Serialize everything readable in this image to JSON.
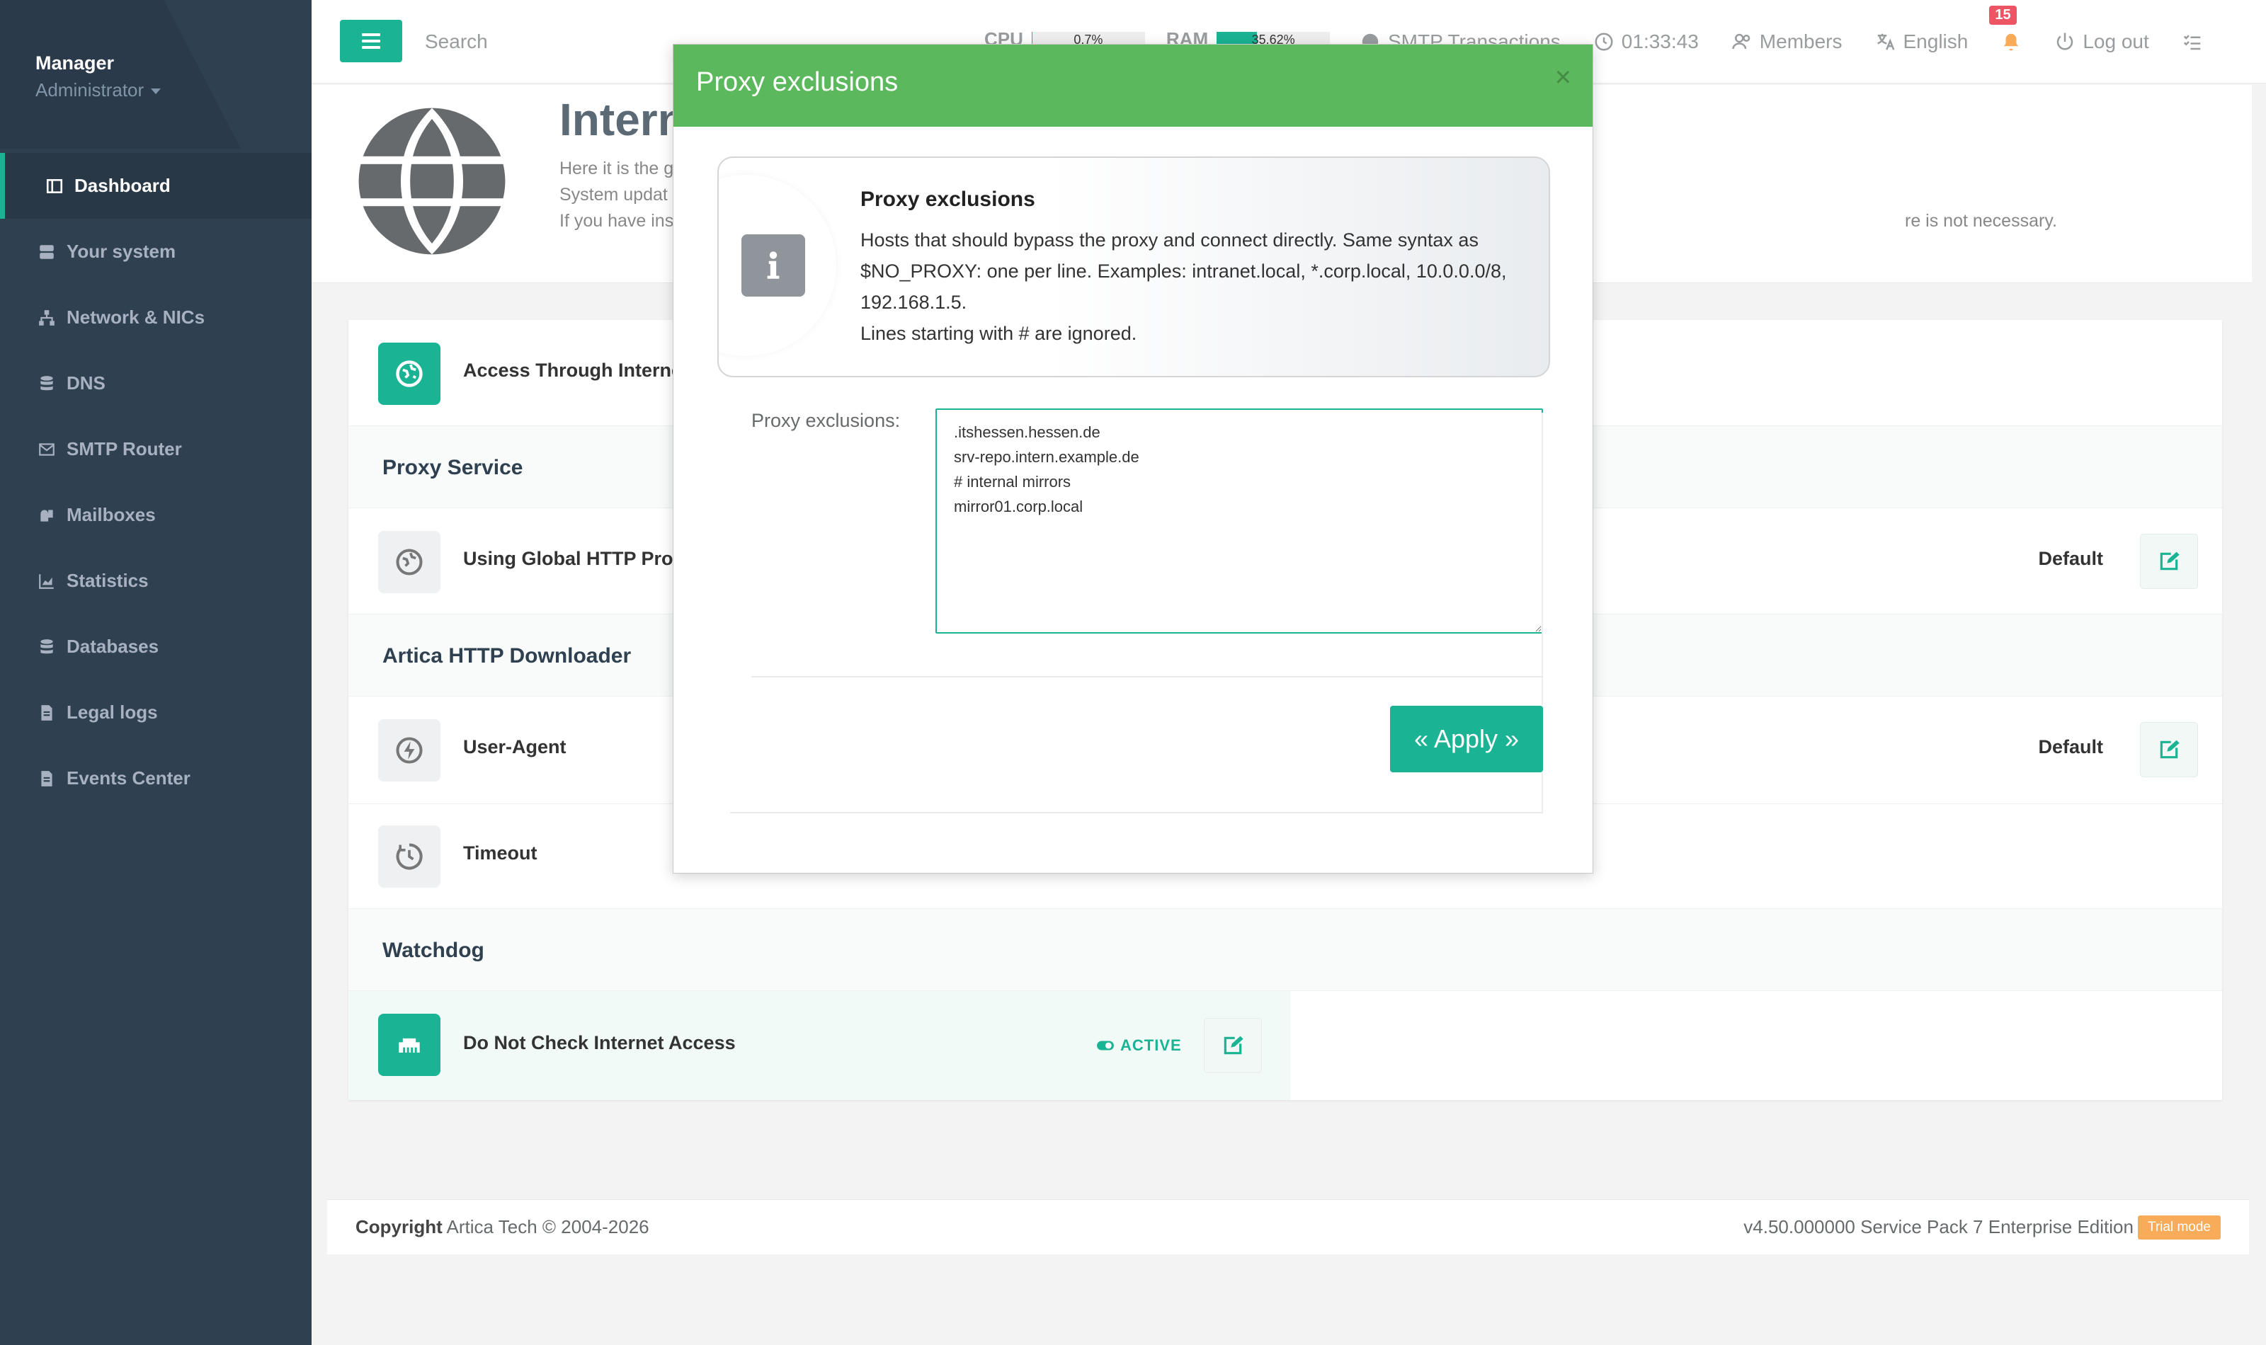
{
  "sidebar": {
    "user_name": "Manager",
    "user_role": "Administrator",
    "items": [
      {
        "label": "Dashboard",
        "icon": "dashboard-icon"
      },
      {
        "label": "Your system",
        "icon": "server-icon"
      },
      {
        "label": "Network & NICs",
        "icon": "network-icon"
      },
      {
        "label": "DNS",
        "icon": "database-icon"
      },
      {
        "label": "SMTP Router",
        "icon": "envelope-icon"
      },
      {
        "label": "Mailboxes",
        "icon": "mailbox-icon"
      },
      {
        "label": "Statistics",
        "icon": "chart-icon"
      },
      {
        "label": "Databases",
        "icon": "database-icon"
      },
      {
        "label": "Legal logs",
        "icon": "file-icon"
      },
      {
        "label": "Events Center",
        "icon": "file-icon"
      }
    ]
  },
  "topbar": {
    "search_placeholder": "Search",
    "cpu_label": "CPU",
    "cpu_value": "0.7%",
    "cpu_fraction": 0.007,
    "ram_label": "RAM",
    "ram_value": "35.62%",
    "ram_fraction": 0.3562,
    "smtp": "SMTP Transactions",
    "clock": "01:33:43",
    "members": "Members",
    "language": "English",
    "notifications": "15",
    "logout": "Log out"
  },
  "header": {
    "title": "Intern",
    "desc_lines": [
      "Here it is the g",
      "System updat",
      "If you have ins"
    ],
    "desc_tail": "re is not necessary."
  },
  "panel": {
    "access_label": "Access Through Internet",
    "proxy_section": "Proxy Service",
    "global_proxy_label": "Using Global HTTP Prox",
    "global_proxy_value": "Default",
    "downloader_section": "Artica HTTP Downloader",
    "user_agent_label": "User-Agent",
    "user_agent_value": "Default",
    "timeout_label": "Timeout",
    "watchdog_section": "Watchdog",
    "no_check_label": "Do Not Check Internet Access",
    "no_check_status": "ACTIVE"
  },
  "footer": {
    "copyright_bold": "Copyright",
    "copyright_rest": " Artica Tech © 2004-2026",
    "version": "v4.50.000000 Service Pack 7 Enterprise Edition",
    "trial": "Trial mode"
  },
  "modal": {
    "title": "Proxy exclusions",
    "close": "×",
    "info_title": "Proxy exclusions",
    "info_text": "Hosts that should bypass the proxy and connect directly. Same syntax as $NO_PROXY: one per line. Examples: intranet.local, *.corp.local, 10.0.0.0/8, 192.168.1.5.",
    "info_text2": "Lines starting with # are ignored.",
    "field_label": "Proxy exclusions",
    "field_value": ".itshessen.hessen.de\nsrv-repo.intern.example.de\n# internal mirrors\nmirror01.corp.local",
    "apply_label": "« Apply »"
  },
  "colors": {
    "accent": "#1ab394",
    "modal_header": "#5cb85c",
    "sidebar": "#2f4050",
    "badge": "#ed5565",
    "trial": "#f8ac59"
  }
}
